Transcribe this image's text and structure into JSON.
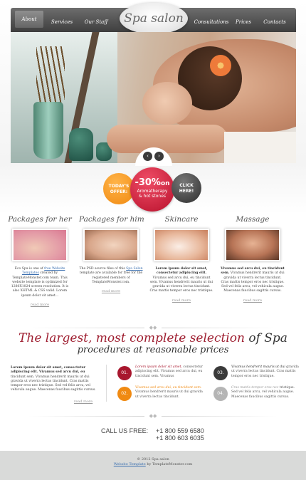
{
  "nav": {
    "items": [
      "About",
      "Services",
      "Our Staff",
      "Consultations",
      "Prices",
      "Contacts"
    ],
    "logo": "Spa salon"
  },
  "slider": {
    "prev": "‹",
    "next": "›"
  },
  "offer": {
    "today_l1": "TODAY'S",
    "today_l2": "OFFER:",
    "pct": "-30%",
    "on": "on",
    "line1": "Aromatherapy",
    "line2": "& hot stones",
    "click_l1": "CLICK",
    "click_l2": "HERE!"
  },
  "packages": [
    {
      "title": "Packages for her",
      "text_pre": "Eco Spa is one of ",
      "link": "free Website Templates",
      "text_post": " created by TemplateMonster.com team. This website template is optimized for 1280X1024 screen resolution. It is also XHTML & CSS valid. Lorem ipsum dolor sit amet...",
      "more": "read more"
    },
    {
      "title": "Packages for him",
      "text_pre": "The PSD source files of this ",
      "link": "Spa Salon",
      "text_post": " template are available for free for the registered members of TemplateMonster.com.",
      "more": "read more"
    },
    {
      "title": "Skincare",
      "bold": "Lorem ipsum dolor sit amet, consectetur adipiscing elit.",
      "text": " Vivamus sed arcu dui, eu tincidunt sem. Vivamus hendrerit mauris ut dui gravida ut viverra lectus tincidunt. Cras mattis tempor eros nec tristique.",
      "more": "read more"
    },
    {
      "title": "Massage",
      "bold": "Vivamus sed arcu dui, eu tincidunt sem.",
      "text": " Vivamus hendrerit mauris ut dui gravida ut viverra lectus tincidunt. Cras mattis tempor eros nec tristique. Sed vel felis arcu, vel vehicula augue. Maecenas faucibus sagittis cursus.",
      "more": "read more"
    }
  ],
  "headline": {
    "line1_a": "The largest, most complete selection",
    "line1_b": " of Spa",
    "line2": "procedures at reasonable prices"
  },
  "intro": {
    "bold": "Lorem ipsum dolor sit amet, consectetur adipiscing elit. Vivamus sed arcu dui, eu",
    "text": " tincidunt sem. Vivamus hendrerit mauris ut dui gravida ut viverra lectus tincidunt. Cras mattis tempor eros nec tristique. Sed vel felis arcu, vel vehicula augue. Maecenas faucibus sagittis cursus.",
    "more": "read more"
  },
  "features": [
    {
      "num": "01.",
      "lead": "Lorem ipsum dolor sit amet,",
      "text": " consectetur adipiscing elit. Vivamus sed arcu dui, eu tincidunt sem. Vivamus",
      "color": "#a8172e"
    },
    {
      "num": "02.",
      "lead": "Vivamus sed arcu dui, eu tincidunt sem.",
      "text": " Vivamus hendrerit mauris ut dui gravida ut viverra lectus tincidunt.",
      "color": "#f08a12"
    },
    {
      "num": "03.",
      "lead": "Vivamus hendrerit mauris ut dui",
      "text": " gravida ut viverra lectus tincidunt. Cras mattis tempor eros nec tristique.",
      "color": "#3a3a3a"
    },
    {
      "num": "04.",
      "lead": "Cras mattis tempor eros nec",
      "text": " tristique. Sed vel felis arcu, vel vehicula augue. Maecenas faucibus sagittis cursus.",
      "color": "#b5b5b5"
    }
  ],
  "call": {
    "label": "CALL US FREE:",
    "phone1": "+1 800 559 6580",
    "phone2": "+1 800 603 6035"
  },
  "footer": {
    "copy": "© 2012 Spa salon",
    "link": "Website Template",
    "by": " by TemplateMonster.com"
  }
}
